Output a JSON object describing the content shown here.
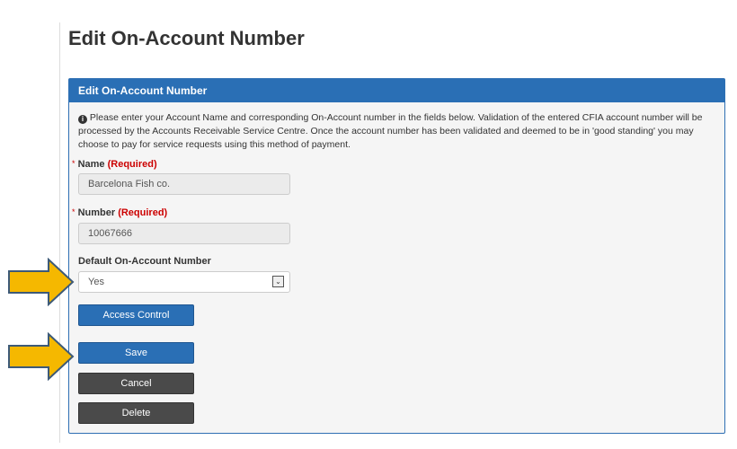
{
  "page": {
    "title": "Edit On-Account Number"
  },
  "panel": {
    "header": "Edit On-Account Number",
    "info_icon": "info-circle-icon",
    "info_text": "Please enter your Account Name and corresponding On-Account number in the fields below. Validation of the entered CFIA account number will be processed by the Accounts Receivable Service Centre. Once the account number has been validated and deemed to be in 'good standing' you may choose to pay for service requests using this method of payment.",
    "name": {
      "asterisk": "*",
      "label": "Name",
      "required": "(Required)",
      "value": "Barcelona Fish co."
    },
    "number": {
      "asterisk": "*",
      "label": "Number",
      "required": "(Required)",
      "value": "10067666"
    },
    "default": {
      "label": "Default On-Account Number",
      "value": "Yes"
    },
    "buttons": {
      "access_control": "Access Control",
      "save": "Save",
      "cancel": "Cancel",
      "delete": "Delete"
    }
  },
  "annotations": {
    "arrow_color": "#f5b800",
    "arrow_outline": "#3d5a78"
  }
}
